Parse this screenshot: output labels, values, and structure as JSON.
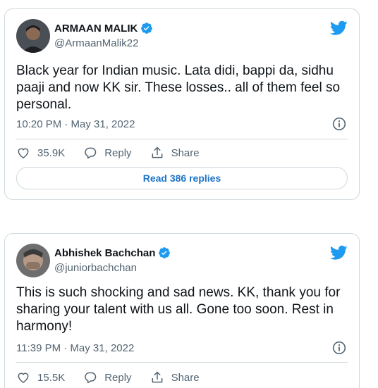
{
  "tweets": [
    {
      "display_name": "ARMAAN MALIK",
      "handle": "@ArmaanMalik22",
      "text": "Black year for Indian music. Lata didi, bappi da, sidhu paaji and now KK sir. These losses.. all of them feel so personal.",
      "timestamp": "10:20 PM · May 31, 2022",
      "likes": "35.9K",
      "reply_label": "Reply",
      "share_label": "Share",
      "read_replies": "Read 386 replies"
    },
    {
      "display_name": "Abhishek Bachchan",
      "handle": "@juniorbachchan",
      "text": "This is such shocking and sad news. KK, thank you for sharing your talent with us all. Gone too soon. Rest in harmony!",
      "timestamp": "11:39 PM · May 31, 2022",
      "likes": "15.5K",
      "reply_label": "Reply",
      "share_label": "Share"
    }
  ],
  "icons": {
    "verified": "verified-badge-icon",
    "bird": "twitter-bird-icon",
    "info": "info-icon",
    "like": "heart-icon",
    "reply": "reply-bubble-icon",
    "share": "share-icon"
  },
  "colors": {
    "accent": "#1d9bf0",
    "link": "#1d74c7",
    "text": "#0f1419",
    "muted": "#536471",
    "border": "#cfd9de"
  }
}
